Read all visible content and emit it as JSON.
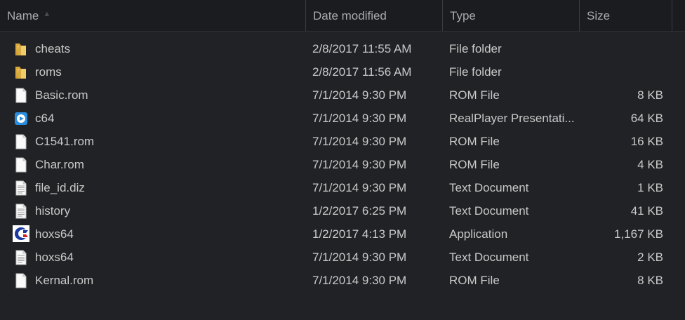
{
  "header": {
    "columns": [
      {
        "label": "Name"
      },
      {
        "label": "Date modified"
      },
      {
        "label": "Type"
      },
      {
        "label": "Size"
      }
    ]
  },
  "files": [
    {
      "name": "cheats",
      "date": "2/8/2017 11:55 AM",
      "type": "File folder",
      "size": "",
      "icon": "folder-icon"
    },
    {
      "name": "roms",
      "date": "2/8/2017 11:56 AM",
      "type": "File folder",
      "size": "",
      "icon": "folder-icon"
    },
    {
      "name": "Basic.rom",
      "date": "7/1/2014 9:30 PM",
      "type": "ROM File",
      "size": "8 KB",
      "icon": "blank-file-icon"
    },
    {
      "name": "c64",
      "date": "7/1/2014 9:30 PM",
      "type": "RealPlayer Presentati...",
      "size": "64 KB",
      "icon": "realplayer-file-icon"
    },
    {
      "name": "C1541.rom",
      "date": "7/1/2014 9:30 PM",
      "type": "ROM File",
      "size": "16 KB",
      "icon": "blank-file-icon"
    },
    {
      "name": "Char.rom",
      "date": "7/1/2014 9:30 PM",
      "type": "ROM File",
      "size": "4 KB",
      "icon": "blank-file-icon"
    },
    {
      "name": "file_id.diz",
      "date": "7/1/2014 9:30 PM",
      "type": "Text Document",
      "size": "1 KB",
      "icon": "text-file-icon"
    },
    {
      "name": "history",
      "date": "1/2/2017 6:25 PM",
      "type": "Text Document",
      "size": "41 KB",
      "icon": "text-file-icon"
    },
    {
      "name": "hoxs64",
      "date": "1/2/2017 4:13 PM",
      "type": "Application",
      "size": "1,167 KB",
      "icon": "commodore-app-icon"
    },
    {
      "name": "hoxs64",
      "date": "7/1/2014 9:30 PM",
      "type": "Text Document",
      "size": "2 KB",
      "icon": "text-file-icon"
    },
    {
      "name": "Kernal.rom",
      "date": "7/1/2014 9:30 PM",
      "type": "ROM File",
      "size": "8 KB",
      "icon": "blank-file-icon"
    }
  ],
  "colors": {
    "background": "#202225",
    "header_bg": "#1b1c1f",
    "text": "#c9c9c9",
    "header_text": "#a9aaad",
    "folder": "#e8c05a"
  }
}
